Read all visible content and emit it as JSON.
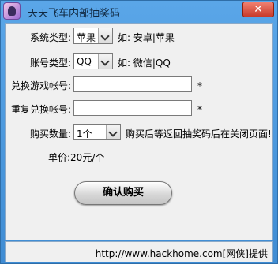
{
  "window": {
    "title": "天天飞车内部抽奖码",
    "close_label": "✕",
    "status_text": "http://www.hackhome.com[网侠]提供"
  },
  "form": {
    "system_label": "系统类型:",
    "system_value": "苹果",
    "system_hint": "如: 安卓|苹果",
    "account_label": "账号类型:",
    "account_value": "QQ",
    "account_hint": "如: 微信|QQ",
    "game_account_label": "兑换游戏帐号:",
    "game_account_value": "",
    "repeat_account_label": "重复兑换帐号:",
    "repeat_account_value": "",
    "required_mark": "*",
    "quantity_label": "购买数量:",
    "quantity_value": "1个",
    "quantity_hint": "购买后等返回抽奖码后在关闭页面!",
    "price_label": "单价:20元/个",
    "confirm_label": "确认购买"
  }
}
